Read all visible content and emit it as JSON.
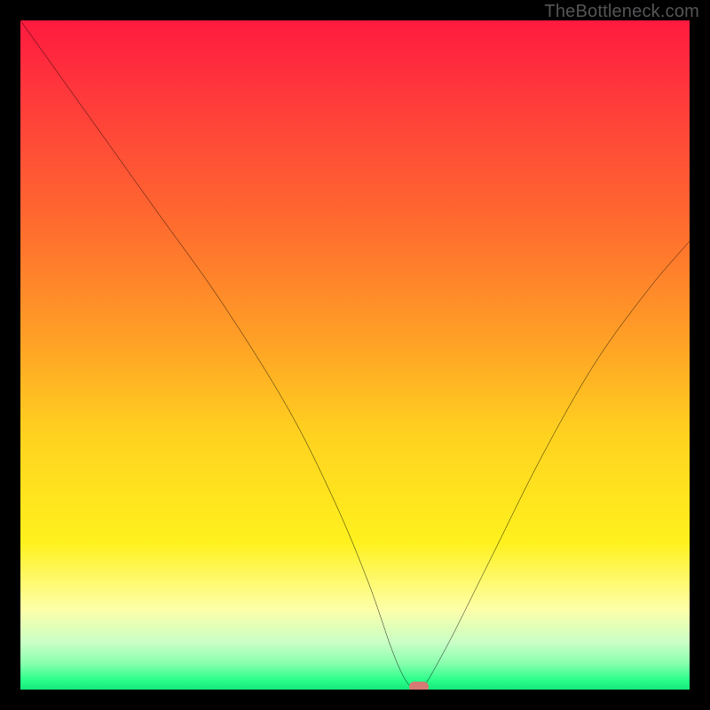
{
  "watermark": "TheBottleneck.com",
  "chart_data": {
    "type": "line",
    "title": "",
    "xlabel": "",
    "ylabel": "",
    "xlim": [
      0,
      100
    ],
    "ylim": [
      0,
      100
    ],
    "grid": false,
    "legend": false,
    "gradient_stops": [
      {
        "offset": 0.0,
        "color": "#ff1a3f"
      },
      {
        "offset": 0.12,
        "color": "#ff3b3b"
      },
      {
        "offset": 0.3,
        "color": "#ff6a2f"
      },
      {
        "offset": 0.48,
        "color": "#ffa126"
      },
      {
        "offset": 0.62,
        "color": "#ffd21f"
      },
      {
        "offset": 0.78,
        "color": "#fff11e"
      },
      {
        "offset": 0.88,
        "color": "#fdffa8"
      },
      {
        "offset": 0.93,
        "color": "#c9ffc6"
      },
      {
        "offset": 0.96,
        "color": "#8affae"
      },
      {
        "offset": 0.985,
        "color": "#2eff8b"
      },
      {
        "offset": 1.0,
        "color": "#13e87a"
      }
    ],
    "series": [
      {
        "name": "bottleneck-curve",
        "x": [
          0,
          10,
          20,
          30,
          40,
          47,
          52,
          55.5,
          57.5,
          59,
          60,
          64,
          70,
          78,
          86,
          94,
          100
        ],
        "y": [
          100,
          86,
          72,
          58,
          42,
          28,
          16,
          6,
          1.5,
          0,
          0,
          7,
          19,
          35,
          49,
          60,
          67
        ]
      }
    ],
    "marker": {
      "x": 59.5,
      "y": 0
    }
  }
}
